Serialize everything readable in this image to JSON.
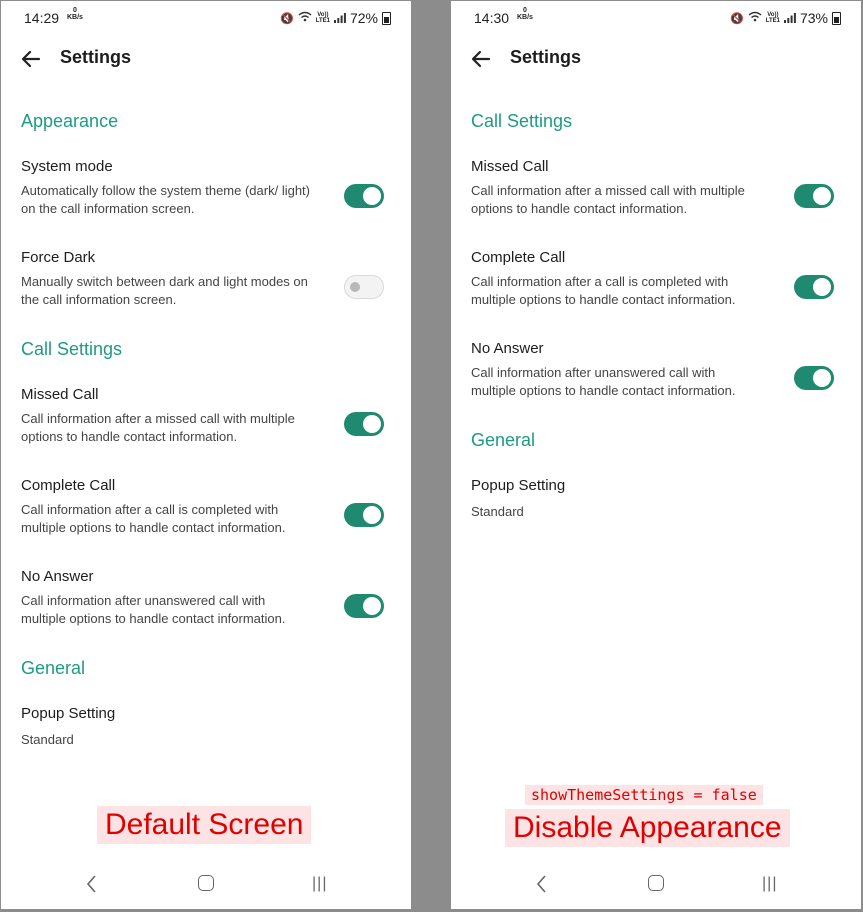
{
  "left": {
    "status": {
      "time": "14:29",
      "kbs_value": "0",
      "kbs_unit": "KB/s",
      "net_top": "Vo))",
      "net_bottom": "LTE1",
      "battery": "72%"
    },
    "title": "Settings",
    "appearance": {
      "header": "Appearance",
      "system_mode": {
        "label": "System mode",
        "desc": "Automatically follow the system theme (dark/ light) on the call information screen.",
        "on": true
      },
      "force_dark": {
        "label": "Force Dark",
        "desc": "Manually switch between dark and light modes on the call information screen.",
        "on": false
      }
    },
    "call_settings": {
      "header": "Call Settings",
      "missed": {
        "label": "Missed Call",
        "desc": "Call information after a missed call with multiple options to handle contact information.",
        "on": true
      },
      "complete": {
        "label": "Complete Call",
        "desc": "Call information after a call is completed with multiple options to handle contact information.",
        "on": true
      },
      "no_answer": {
        "label": "No Answer",
        "desc": "Call information after unanswered call with multiple options to handle contact information.",
        "on": true
      }
    },
    "general": {
      "header": "General",
      "popup_label": "Popup Setting",
      "popup_value": "Standard"
    },
    "caption": "Default Screen"
  },
  "right": {
    "status": {
      "time": "14:30",
      "kbs_value": "0",
      "kbs_unit": "KB/s",
      "net_top": "Vo))",
      "net_bottom": "LTE1",
      "battery": "73%"
    },
    "title": "Settings",
    "call_settings": {
      "header": "Call Settings",
      "missed": {
        "label": "Missed Call",
        "desc": "Call information after a missed call with multiple options to handle contact information.",
        "on": true
      },
      "complete": {
        "label": "Complete Call",
        "desc": "Call information after a call is completed with multiple options to handle contact information.",
        "on": true
      },
      "no_answer": {
        "label": "No Answer",
        "desc": "Call information after unanswered call with multiple options to handle contact information.",
        "on": true
      }
    },
    "general": {
      "header": "General",
      "popup_label": "Popup Setting",
      "popup_value": "Standard"
    },
    "caption_code": "showThemeSettings = false",
    "caption": "Disable Appearance"
  },
  "colors": {
    "accent": "#1f9a84",
    "toggle_on": "#1f8a6f",
    "caption_red": "#e00000"
  }
}
